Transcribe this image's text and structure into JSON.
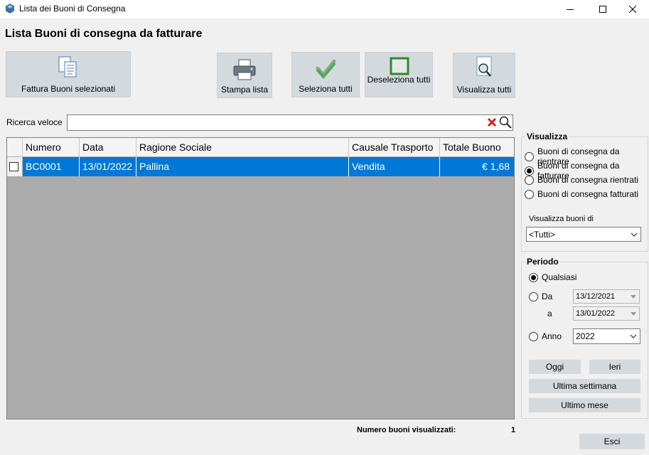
{
  "window": {
    "title": "Lista dei Buoni di Consegna",
    "page_title": "Lista Buoni di consegna da fatturare"
  },
  "toolbar": {
    "fattura_label": "Fattura Buoni selezionati",
    "stampa_label": "Stampa lista",
    "seleziona_label": "Seleziona tutti",
    "deseleziona_label": "Deseleziona tutti",
    "visualizza_label": "Visualizza tutti"
  },
  "search": {
    "label": "Ricerca veloce",
    "value": ""
  },
  "grid": {
    "columns": [
      "Numero",
      "Data",
      "Ragione Sociale",
      "Causale Trasporto",
      "Totale Buono"
    ],
    "rows": [
      {
        "numero": "BC0001",
        "data": "13/01/2022",
        "ragione_sociale": "Pallina",
        "causale": "Vendita",
        "totale": "€ 1,68",
        "selected": true
      }
    ]
  },
  "visualizza": {
    "title": "Visualizza",
    "options": [
      {
        "label": "Buoni di consegna da rientrare",
        "checked": false
      },
      {
        "label": "Buoni di consegna da fatturare",
        "checked": true
      },
      {
        "label": "Buoni di consegna rientrati",
        "checked": false
      },
      {
        "label": "Buoni di consegna fatturati",
        "checked": false
      }
    ],
    "filter_label": "Visualizza buoni di",
    "filter_value": "<Tutti>"
  },
  "periodo": {
    "title": "Periodo",
    "qualsiasi": "Qualsiasi",
    "da_label": "Da",
    "da_value": "13/12/2021",
    "a_label": "a",
    "a_value": "13/01/2022",
    "anno_label": "Anno",
    "anno_value": "2022",
    "oggi": "Oggi",
    "ieri": "Ieri",
    "ultima_settimana": "Ultima settimana",
    "ultimo_mese": "Ultimo mese",
    "selected": "qualsiasi"
  },
  "footer": {
    "count_label": "Numero buoni visualizzati:",
    "count_value": "1",
    "esci": "Esci"
  },
  "colors": {
    "selection": "#0078d7",
    "button": "#d4d9de",
    "grid_bg": "#ababab"
  }
}
